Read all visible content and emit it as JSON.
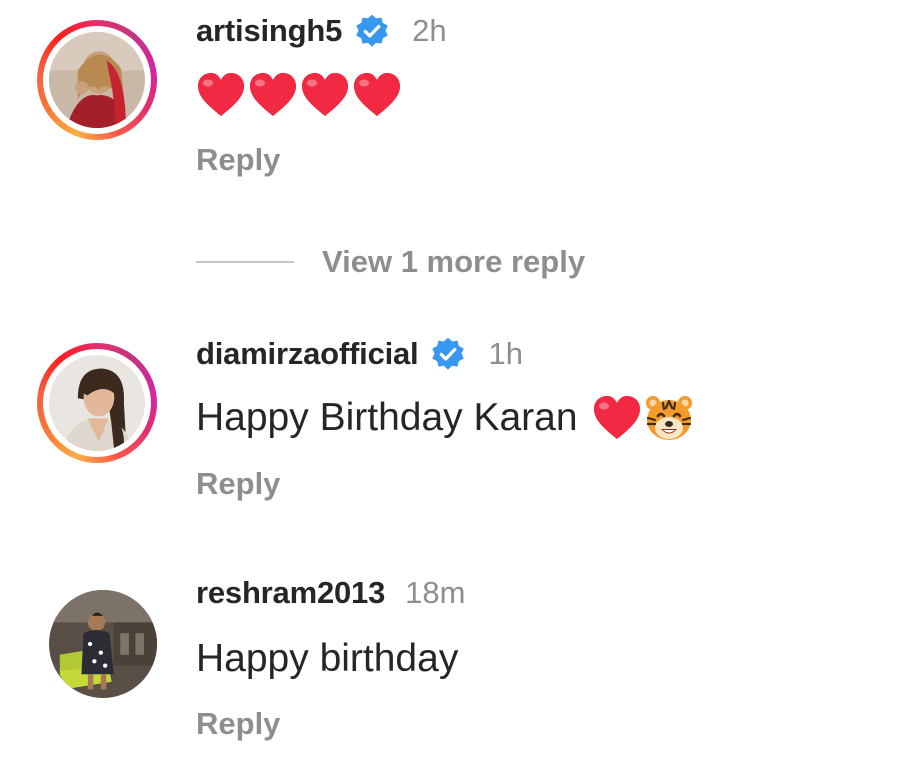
{
  "comments": [
    {
      "username": "artisingh5",
      "verified": true,
      "time": "2h",
      "text": "",
      "emoji": [
        "heart",
        "heart",
        "heart",
        "heart"
      ],
      "reply_label": "Reply",
      "has_story_ring": true
    },
    {
      "username": "diamirzaofficial",
      "verified": true,
      "time": "1h",
      "text": "Happy Birthday Karan",
      "emoji": [
        "heart",
        "tiger"
      ],
      "reply_label": "Reply",
      "has_story_ring": true
    },
    {
      "username": "reshram2013",
      "verified": false,
      "time": "18m",
      "text": "Happy birthday",
      "emoji": [],
      "reply_label": "Reply",
      "has_story_ring": false
    }
  ],
  "view_more": {
    "label": "View 1 more reply"
  },
  "colors": {
    "verified_badge": "#3897f0",
    "heart": "#e0245e",
    "secondary_text": "#8e8e8e",
    "primary_text": "#262626"
  },
  "icons": {
    "verified": "verified-badge-icon",
    "heart": "red-heart-emoji",
    "tiger": "tiger-face-emoji"
  }
}
